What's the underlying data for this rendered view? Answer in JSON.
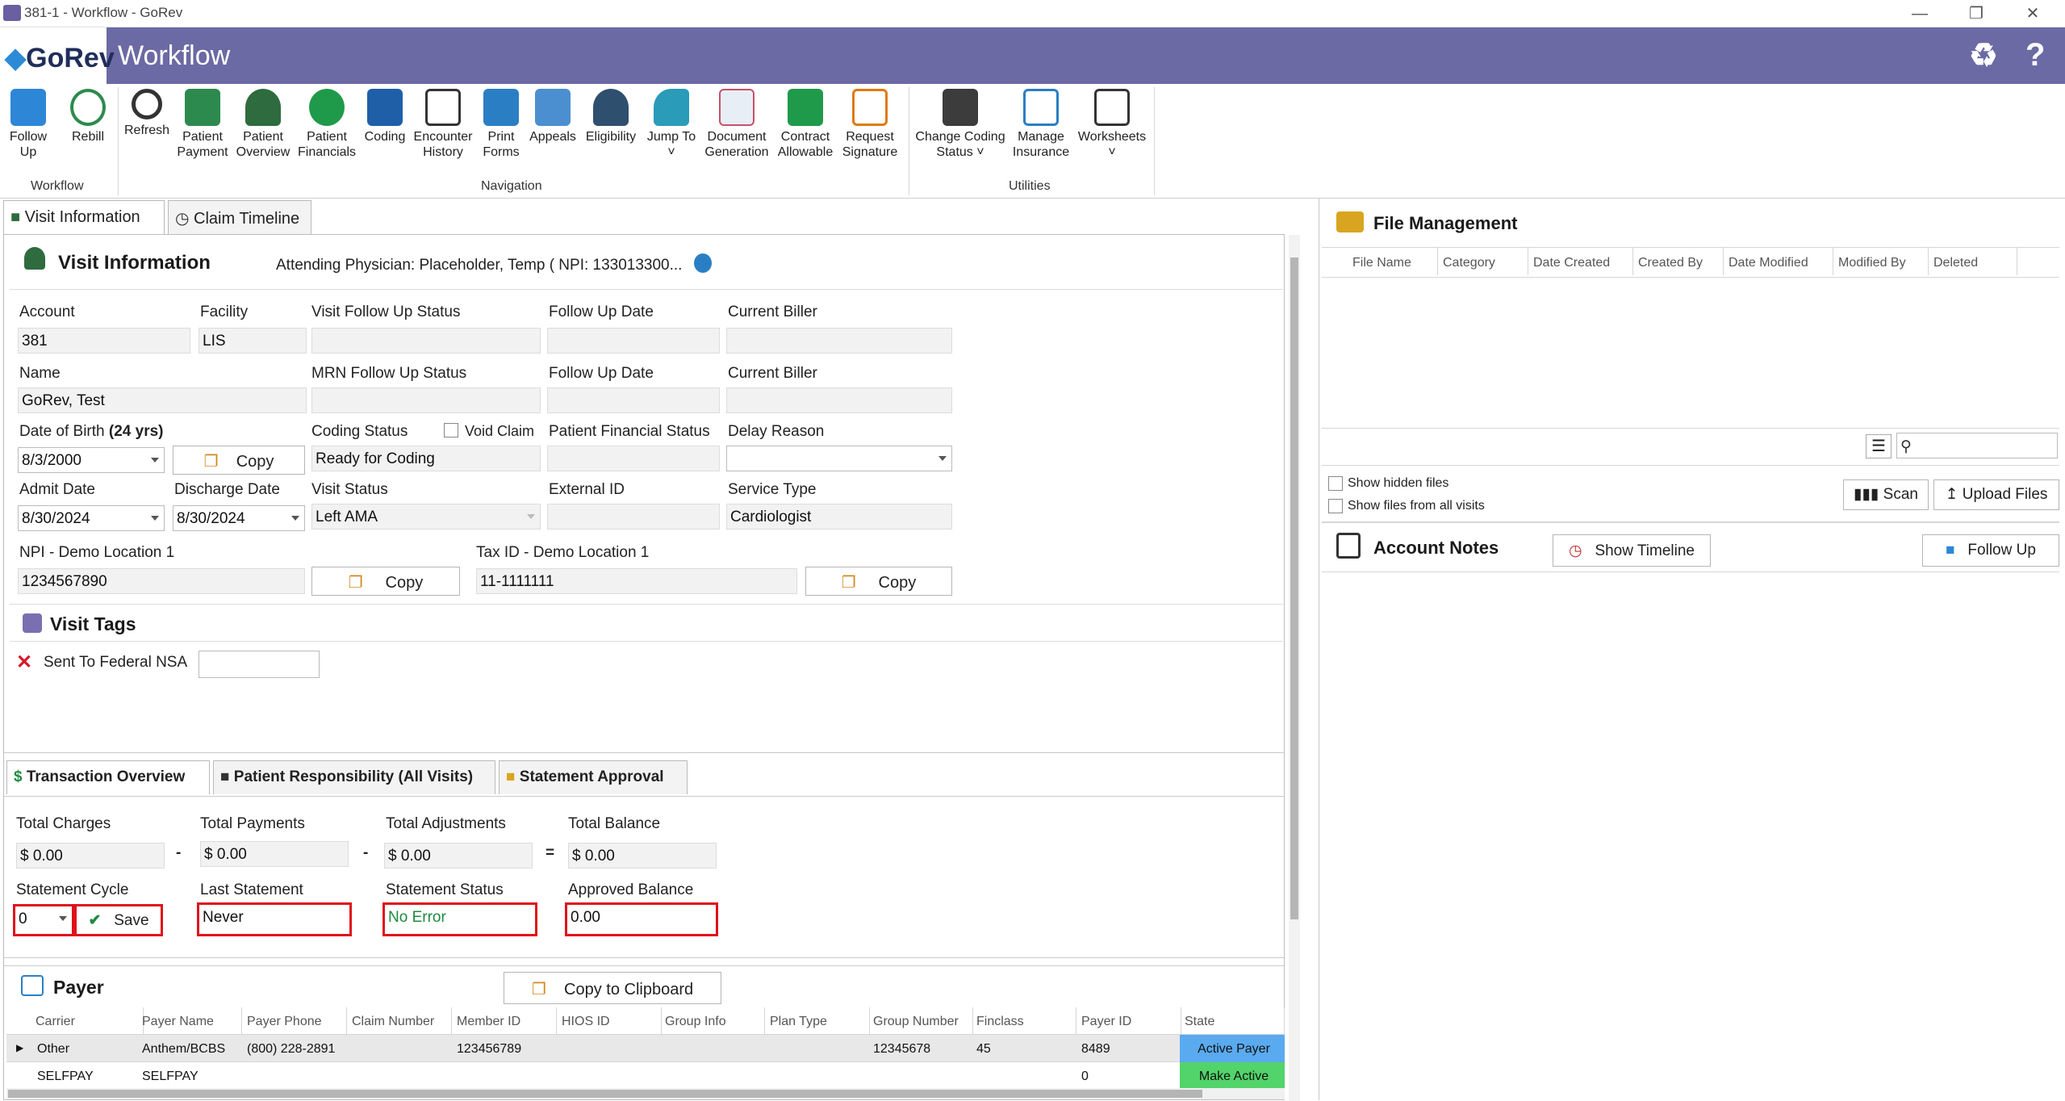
{
  "window": {
    "title": "381-1 - Workflow - GoRev"
  },
  "header": {
    "logo": "GoRev",
    "title": "Workflow"
  },
  "ribbon": {
    "workflow": [
      {
        "label": "Follow\nUp",
        "l1": "Follow",
        "l2": "Up"
      },
      {
        "l1": "Rebill",
        "l2": ""
      }
    ],
    "workflow_label": "Workflow",
    "navigation": [
      {
        "l1": "Refresh",
        "l2": ""
      },
      {
        "l1": "Patient",
        "l2": "Payment"
      },
      {
        "l1": "Patient",
        "l2": "Overview"
      },
      {
        "l1": "Patient",
        "l2": "Financials"
      },
      {
        "l1": "Coding",
        "l2": ""
      },
      {
        "l1": "Encounter",
        "l2": "History"
      },
      {
        "l1": "Print",
        "l2": "Forms"
      },
      {
        "l1": "Appeals",
        "l2": ""
      },
      {
        "l1": "Eligibility",
        "l2": ""
      },
      {
        "l1": "Jump To",
        "l2": "˅"
      },
      {
        "l1": "Document",
        "l2": "Generation"
      },
      {
        "l1": "Contract",
        "l2": "Allowable"
      },
      {
        "l1": "Request",
        "l2": "Signature"
      }
    ],
    "navigation_label": "Navigation",
    "utilities": [
      {
        "l1": "Change Coding",
        "l2": "Status ˅"
      },
      {
        "l1": "Manage",
        "l2": "Insurance"
      },
      {
        "l1": "Worksheets",
        "l2": "˅"
      }
    ],
    "utilities_label": "Utilities"
  },
  "tabs": {
    "visit_info": "Visit Information",
    "claim_timeline": "Claim Timeline"
  },
  "visit": {
    "title": "Visit Information",
    "attending": "Attending Physician: Placeholder, Temp ( NPI: 133013300...",
    "account_label": "Account",
    "account": "381",
    "facility_label": "Facility",
    "facility": "LIS",
    "visit_fu_status_label": "Visit Follow Up Status",
    "visit_fu_status": "",
    "fu_date_label": "Follow Up Date",
    "fu_date": "",
    "current_biller_label": "Current Biller",
    "current_biller": "",
    "name_label": "Name",
    "name": "GoRev, Test",
    "mrn_fu_status_label": "MRN Follow Up Status",
    "fu_date2_label": "Follow Up Date",
    "current_biller2_label": "Current Biller",
    "dob_label": "Date of Birth",
    "dob_age": "(24 yrs)",
    "dob": "8/3/2000",
    "copy": "Copy",
    "coding_status_label": "Coding Status",
    "coding_status": "Ready for Coding",
    "void_claim": "Void Claim",
    "pfs_label": "Patient Financial Status",
    "delay_reason_label": "Delay Reason",
    "admit_label": "Admit Date",
    "admit": "8/30/2024",
    "discharge_label": "Discharge Date",
    "discharge": "8/30/2024",
    "visit_status_label": "Visit Status",
    "visit_status": "Left AMA",
    "external_id_label": "External ID",
    "service_type_label": "Service Type",
    "service_type": "Cardiologist",
    "npi_label": "NPI - Demo Location 1",
    "npi": "1234567890",
    "tax_label": "Tax ID - Demo Location 1",
    "tax": "11-1111111"
  },
  "tags": {
    "title": "Visit Tags",
    "tag1": "Sent To Federal NSA"
  },
  "fin_tabs": {
    "t1": "Transaction Overview",
    "t2": "Patient Responsibility (All Visits)",
    "t3": "Statement Approval"
  },
  "fin": {
    "total_charges_label": "Total Charges",
    "total_charges": "$ 0.00",
    "total_payments_label": "Total Payments",
    "total_payments": "$ 0.00",
    "total_adj_label": "Total Adjustments",
    "total_adj": "$ 0.00",
    "total_balance_label": "Total Balance",
    "total_balance": "$ 0.00",
    "op_minus": "-",
    "op_eq": "=",
    "stmt_cycle_label": "Statement Cycle",
    "stmt_cycle": "0",
    "save": "Save",
    "last_stmt_label": "Last Statement",
    "last_stmt": "Never",
    "stmt_status_label": "Statement Status",
    "stmt_status": "No Error",
    "approved_label": "Approved Balance",
    "approved": "0.00"
  },
  "payer": {
    "title": "Payer",
    "copy_clip": "Copy to Clipboard",
    "columns": [
      "Carrier",
      "Payer Name",
      "Payer Phone",
      "Claim Number",
      "Member ID",
      "HIOS ID",
      "Group Info",
      "Plan Type",
      "Group Number",
      "Finclass",
      "Payer ID",
      "State"
    ],
    "rows": [
      [
        "Other",
        "Anthem/BCBS",
        "(800) 228-2891",
        "",
        "123456789",
        "",
        "",
        "",
        "12345678",
        "45",
        "8489",
        "Active Payer"
      ],
      [
        "SELFPAY",
        "SELFPAY",
        "",
        "",
        "",
        "",
        "",
        "",
        "",
        "",
        "0",
        "Make Active"
      ]
    ]
  },
  "files": {
    "title": "File Management",
    "columns": [
      "File Name",
      "Category",
      "Date Created",
      "Created By",
      "Date Modified",
      "Modified By",
      "Deleted"
    ],
    "show_hidden": "Show hidden files",
    "show_all": "Show files from all visits",
    "scan": "Scan",
    "upload": "Upload Files"
  },
  "notes": {
    "title": "Account Notes",
    "show_timeline": "Show Timeline",
    "follow_up": "Follow Up"
  }
}
